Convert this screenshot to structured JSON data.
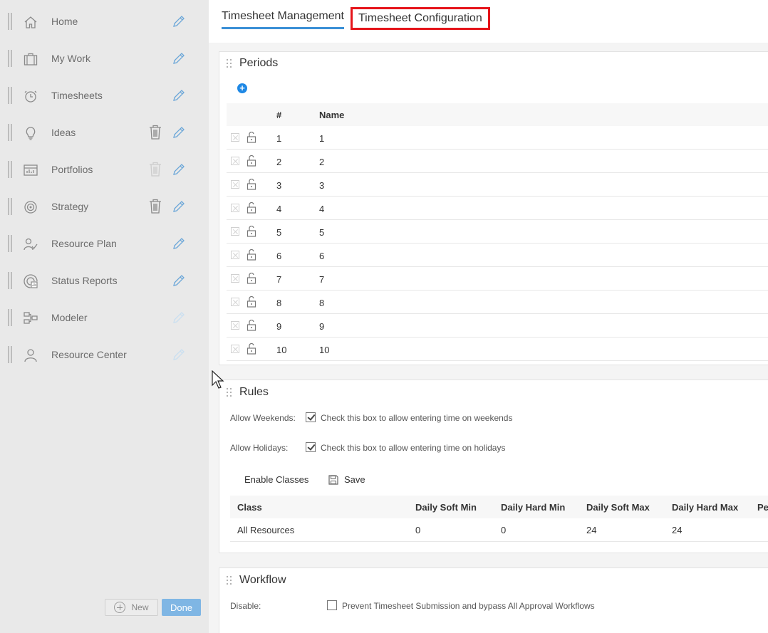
{
  "sidebar": {
    "items": [
      {
        "label": "Home",
        "icon": "home-icon",
        "trash": false,
        "trash_faded": false,
        "pencil_faded": false
      },
      {
        "label": "My Work",
        "icon": "briefcase-icon",
        "trash": false,
        "trash_faded": false,
        "pencil_faded": false
      },
      {
        "label": "Timesheets",
        "icon": "clock-icon",
        "trash": false,
        "trash_faded": false,
        "pencil_faded": false
      },
      {
        "label": "Ideas",
        "icon": "lightbulb-icon",
        "trash": true,
        "trash_faded": false,
        "pencil_faded": false
      },
      {
        "label": "Portfolios",
        "icon": "chart-board-icon",
        "trash": true,
        "trash_faded": true,
        "pencil_faded": false
      },
      {
        "label": "Strategy",
        "icon": "target-icon",
        "trash": true,
        "trash_faded": false,
        "pencil_faded": false
      },
      {
        "label": "Resource Plan",
        "icon": "people-check-icon",
        "trash": false,
        "trash_faded": false,
        "pencil_faded": false
      },
      {
        "label": "Status Reports",
        "icon": "status-report-icon",
        "trash": false,
        "trash_faded": false,
        "pencil_faded": false
      },
      {
        "label": "Modeler",
        "icon": "modeler-icon",
        "trash": false,
        "trash_faded": false,
        "pencil_faded": true
      },
      {
        "label": "Resource Center",
        "icon": "person-icon",
        "trash": false,
        "trash_faded": false,
        "pencil_faded": true
      }
    ],
    "new_label": "New",
    "done_label": "Done"
  },
  "tabs": {
    "management": "Timesheet Management",
    "configuration": "Timesheet Configuration"
  },
  "periods": {
    "title": "Periods",
    "headers": {
      "num": "#",
      "name": "Name"
    },
    "rows": [
      {
        "num": "1",
        "name": "1"
      },
      {
        "num": "2",
        "name": "2"
      },
      {
        "num": "3",
        "name": "3"
      },
      {
        "num": "4",
        "name": "4"
      },
      {
        "num": "5",
        "name": "5"
      },
      {
        "num": "6",
        "name": "6"
      },
      {
        "num": "7",
        "name": "7"
      },
      {
        "num": "8",
        "name": "8"
      },
      {
        "num": "9",
        "name": "9"
      },
      {
        "num": "10",
        "name": "10"
      }
    ]
  },
  "rules": {
    "title": "Rules",
    "weekends_label": "Allow Weekends:",
    "weekends_desc": "Check this box to allow entering time on weekends",
    "holidays_label": "Allow Holidays:",
    "holidays_desc": "Check this box to allow entering time on holidays",
    "enable_classes": "Enable Classes",
    "save": "Save",
    "class_headers": [
      "Class",
      "Daily Soft Min",
      "Daily Hard Min",
      "Daily Soft Max",
      "Daily Hard Max",
      "Pe"
    ],
    "class_rows": [
      [
        "All Resources",
        "0",
        "0",
        "24",
        "24",
        ""
      ]
    ]
  },
  "workflow": {
    "title": "Workflow",
    "disable_label": "Disable:",
    "disable_desc": "Prevent Timesheet Submission and bypass All Approval Workflows"
  },
  "colors": {
    "accent": "#1e88e5",
    "tab_underline": "#3a8fd6",
    "highlight_box": "#e5141a",
    "done_button": "#7fb6e4"
  }
}
